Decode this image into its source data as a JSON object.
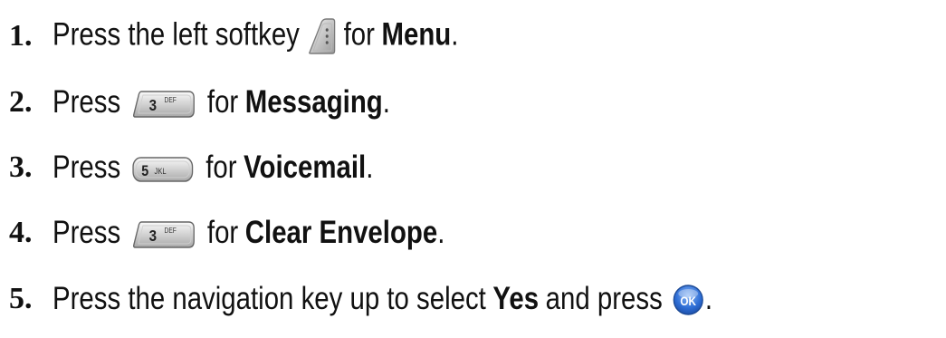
{
  "steps": [
    {
      "number": "1.",
      "before": "Press the left softkey",
      "key_icon": "left-softkey-icon",
      "after": "for",
      "bold": "Menu",
      "end": "."
    },
    {
      "number": "2.",
      "before": "Press",
      "key_icon": "key-3-def-icon",
      "key_digit": "3",
      "key_letters": "DEF",
      "after": "for",
      "bold": "Messaging",
      "end": "."
    },
    {
      "number": "3.",
      "before": "Press",
      "key_icon": "key-5-jkl-icon",
      "key_digit": "5",
      "key_letters": "JKL",
      "after": "for",
      "bold": "Voicemail",
      "end": "."
    },
    {
      "number": "4.",
      "before": "Press",
      "key_icon": "key-3-def-icon",
      "key_digit": "3",
      "key_letters": "DEF",
      "after": "for",
      "bold": "Clear Envelope",
      "end": "."
    },
    {
      "number": "5.",
      "before": "Press the navigation key up to select",
      "bold": "Yes",
      "after": "and press",
      "key_icon": "ok-key-icon",
      "key_label": "OK",
      "end": "."
    }
  ],
  "colors": {
    "text": "#111111",
    "ok_key": "#2f6fd6"
  }
}
